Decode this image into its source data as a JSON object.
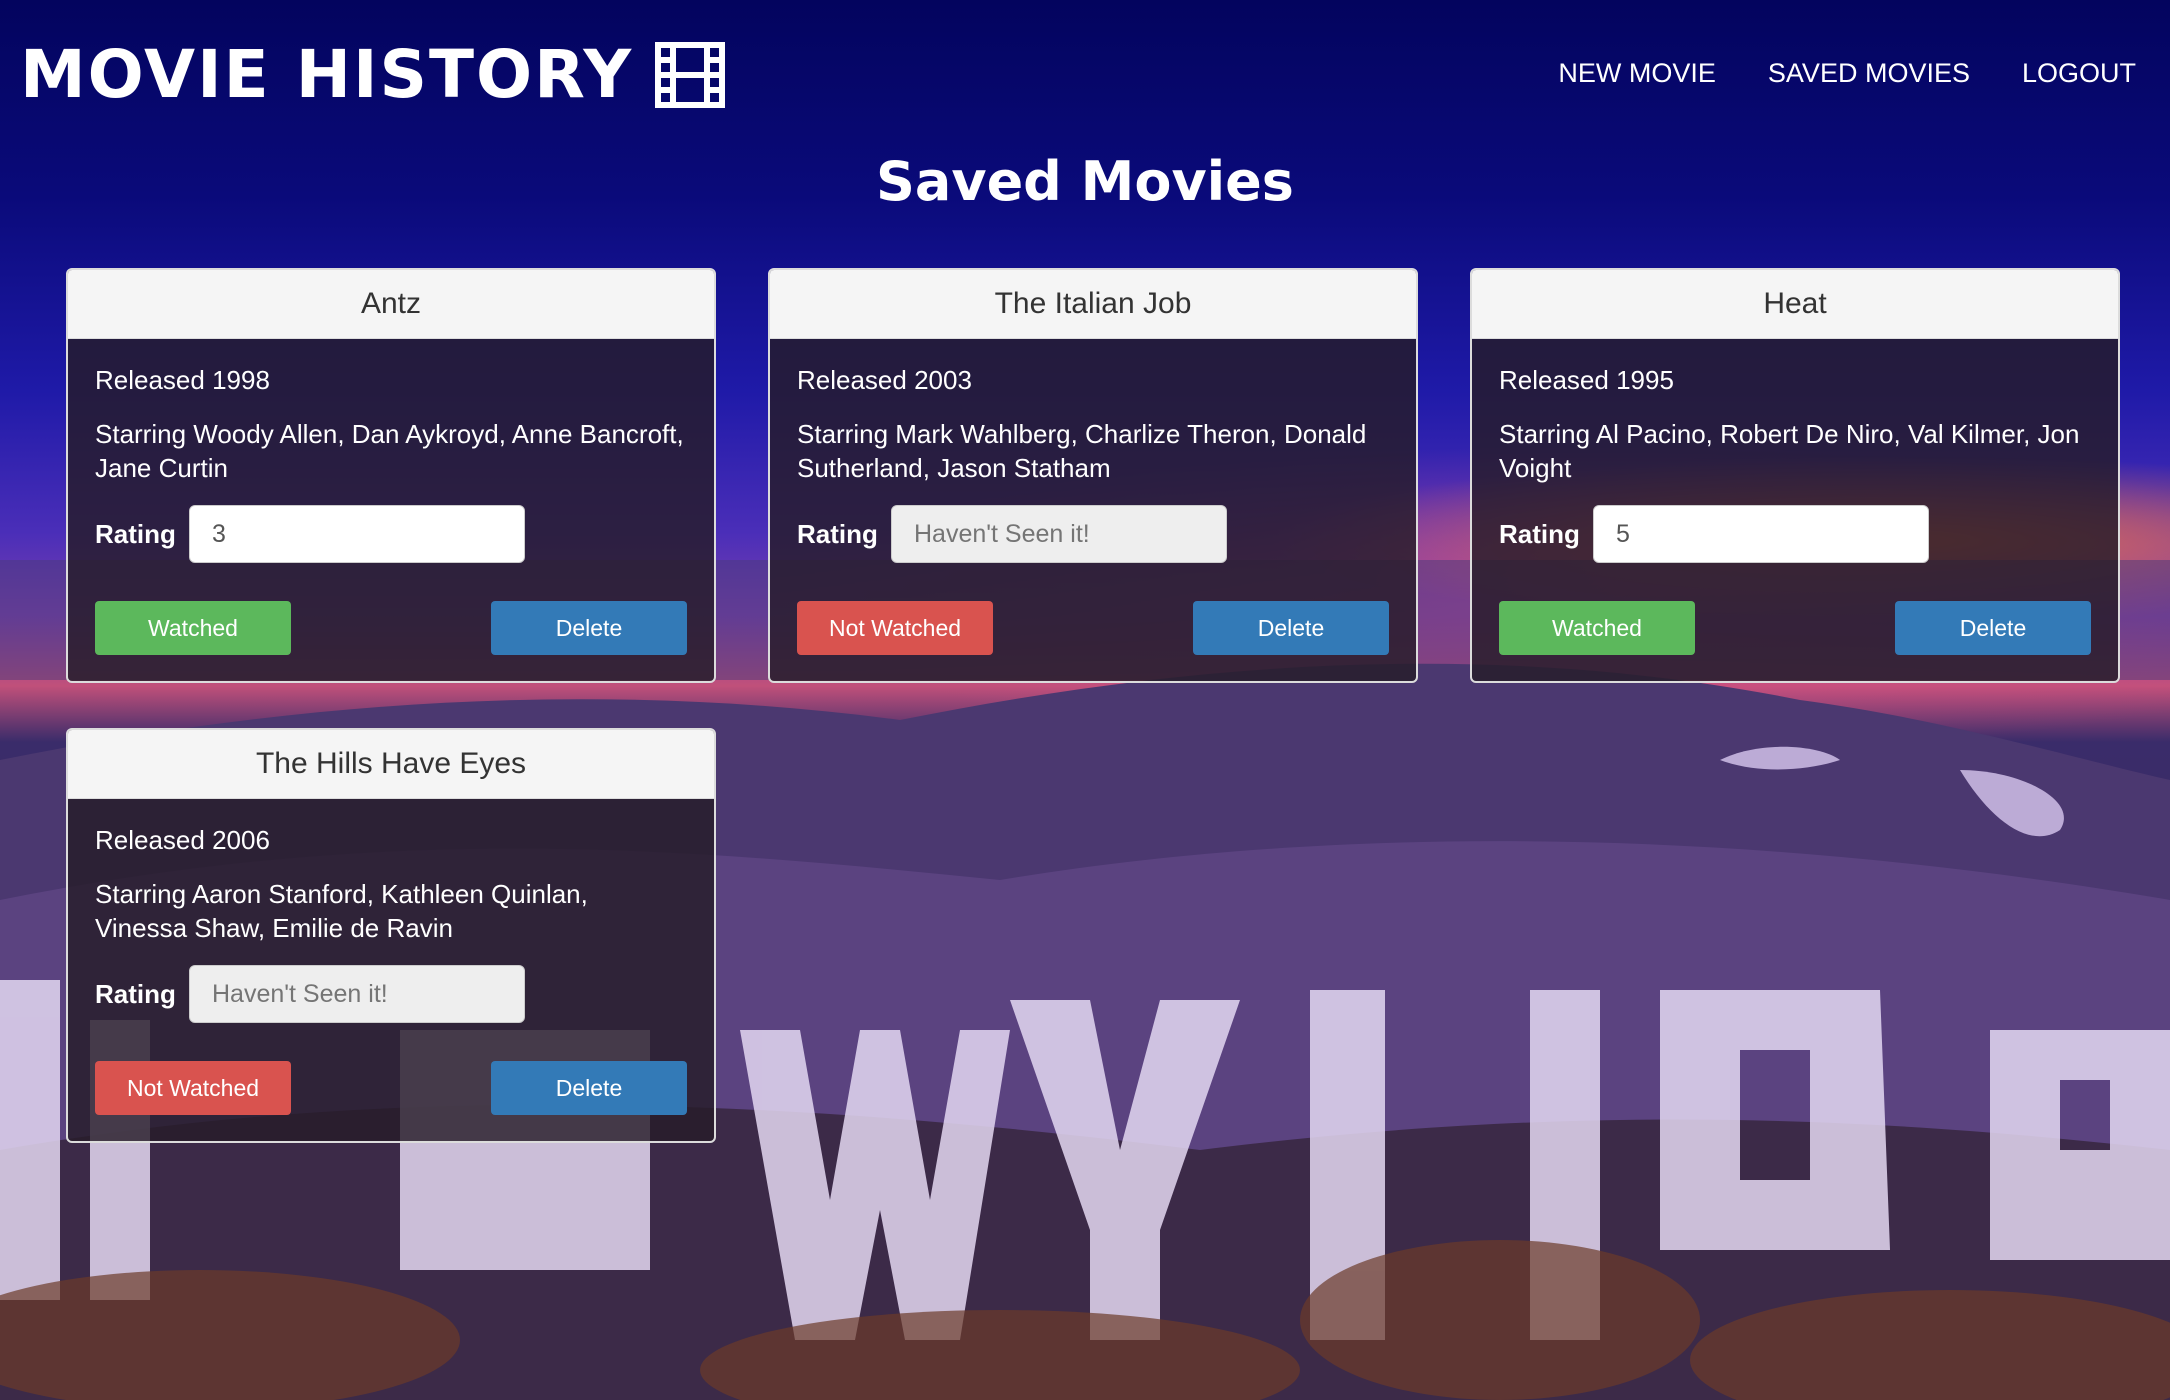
{
  "navbar": {
    "brand": "MOVIE HISTORY",
    "brand_icon": "film-icon",
    "links": {
      "new_movie": "NEW MOVIE",
      "saved_movies": "SAVED MOVIES",
      "logout": "LOGOUT"
    }
  },
  "page": {
    "title": "Saved Movies"
  },
  "movies": [
    {
      "title": "Antz",
      "released": "Released 1998",
      "starring": "Starring Woody Allen, Dan Aykroyd, Anne Bancroft, Jane Curtin",
      "rating_label": "Rating",
      "rating_value": "3",
      "watch_button": "Watched",
      "delete_button": "Delete"
    },
    {
      "title": "The Italian Job",
      "released": "Released 2003",
      "starring": "Starring Mark Wahlberg, Charlize Theron, Donald Sutherland, Jason Statham",
      "rating_label": "Rating",
      "rating_placeholder": "Haven't Seen it!",
      "watch_button": "Not Watched",
      "delete_button": "Delete"
    },
    {
      "title": "Heat",
      "released": "Released 1995",
      "starring": "Starring Al Pacino, Robert De Niro, Val Kilmer, Jon Voight",
      "rating_label": "Rating",
      "rating_value": "5",
      "watch_button": "Watched",
      "delete_button": "Delete"
    },
    {
      "title": "The Hills Have Eyes",
      "released": "Released 2006",
      "starring": "Starring Aaron Stanford, Kathleen Quinlan, Vinessa Shaw, Emilie de Ravin",
      "rating_label": "Rating",
      "rating_placeholder": "Haven't Seen it!",
      "watch_button": "Not Watched",
      "delete_button": "Delete"
    }
  ],
  "colors": {
    "watched": "#5cb85c",
    "not_watched": "#d9534f",
    "delete": "#337ab7"
  }
}
